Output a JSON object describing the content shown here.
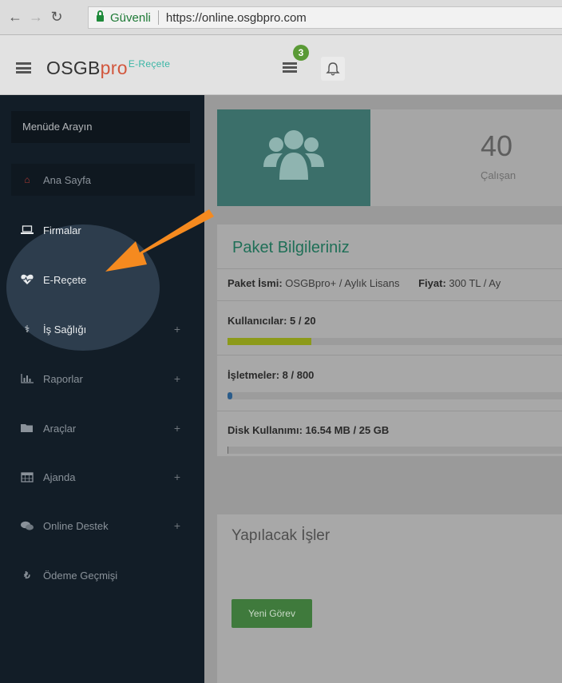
{
  "browser": {
    "secure_label": "Güvenli",
    "url": "https://online.osgbpro.com"
  },
  "header": {
    "brand_main": "OSGB",
    "brand_pro": "pro",
    "brand_sub": "E-Reçete",
    "tasks_badge": "3"
  },
  "sidebar": {
    "search_placeholder": "Menüde Arayın",
    "items": [
      {
        "label": "Ana Sayfa",
        "icon": "home-icon",
        "expandable": false
      },
      {
        "label": "Firmalar",
        "icon": "laptop-icon",
        "expandable": false
      },
      {
        "label": "E-Reçete",
        "icon": "heartbeat-icon",
        "expandable": false
      },
      {
        "label": "İş Sağlığı",
        "icon": "stethoscope-icon",
        "expandable": true
      },
      {
        "label": "Raporlar",
        "icon": "bar-chart-icon",
        "expandable": true
      },
      {
        "label": "Araçlar",
        "icon": "folder-icon",
        "expandable": true
      },
      {
        "label": "Ajanda",
        "icon": "calendar-icon",
        "expandable": true
      },
      {
        "label": "Online Destek",
        "icon": "chat-icon",
        "expandable": true
      },
      {
        "label": "Ödeme Geçmişi",
        "icon": "lira-icon",
        "expandable": false
      }
    ],
    "plus": "+"
  },
  "stats": {
    "value": "40",
    "label": "Çalışan"
  },
  "package": {
    "title": "Paket Bilgileriniz",
    "name_label": "Paket İsmi:",
    "name_value": "OSGBpro+ / Aylık Lisans",
    "price_label": "Fiyat:",
    "price_value": "300 TL / Ay",
    "users_text": "Kullanıcılar: 5 / 20",
    "users_fraction": 0.25,
    "businesses_text": "İşletmeler: 8 / 800",
    "businesses_fraction": 0.01,
    "disk_text": "Disk Kullanımı: 16.54 MB / 25 GB",
    "disk_fraction": 0.001
  },
  "todo": {
    "title": "Yapılacak İşler",
    "new_button": "Yeni Görev"
  },
  "colors": {
    "users_bar": "#8c9a1a",
    "businesses_bar": "#2b5c8a",
    "disk_bar": "#666666",
    "accent_teal": "#3bb6a6",
    "brand_red": "#d2573d",
    "arrow": "#f58a1f"
  }
}
